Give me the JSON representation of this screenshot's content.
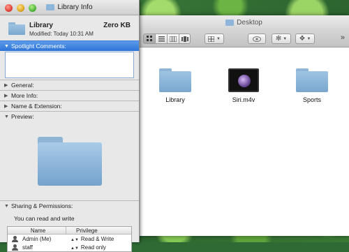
{
  "finder": {
    "title": "Desktop",
    "toolbar": {
      "view_icon": "icon-view",
      "list_view": "list-view",
      "column_view": "column-view",
      "coverflow_view": "coverflow-view",
      "arrange": "arrange",
      "overflow": "»"
    },
    "items": [
      {
        "label": "Library",
        "icon": "folder"
      },
      {
        "label": "Siri.m4v",
        "icon": "movie"
      },
      {
        "label": "Sports",
        "icon": "folder"
      }
    ]
  },
  "info": {
    "title": "Library Info",
    "name": "Library",
    "size": "Zero KB",
    "modified": "Modified: Today 10:31 AM",
    "sections": {
      "spotlight": "Spotlight Comments:",
      "general": "General:",
      "more_info": "More Info:",
      "name_ext": "Name & Extension:",
      "preview": "Preview:",
      "sharing": "Sharing & Permissions:"
    },
    "permissions_text": "You can read and write",
    "table": {
      "col_name": "Name",
      "col_privilege": "Privilege",
      "rows": [
        {
          "name": "Admin (Me)",
          "privilege": "Read & Write"
        },
        {
          "name": "staff",
          "privilege": "Read only"
        }
      ]
    }
  }
}
